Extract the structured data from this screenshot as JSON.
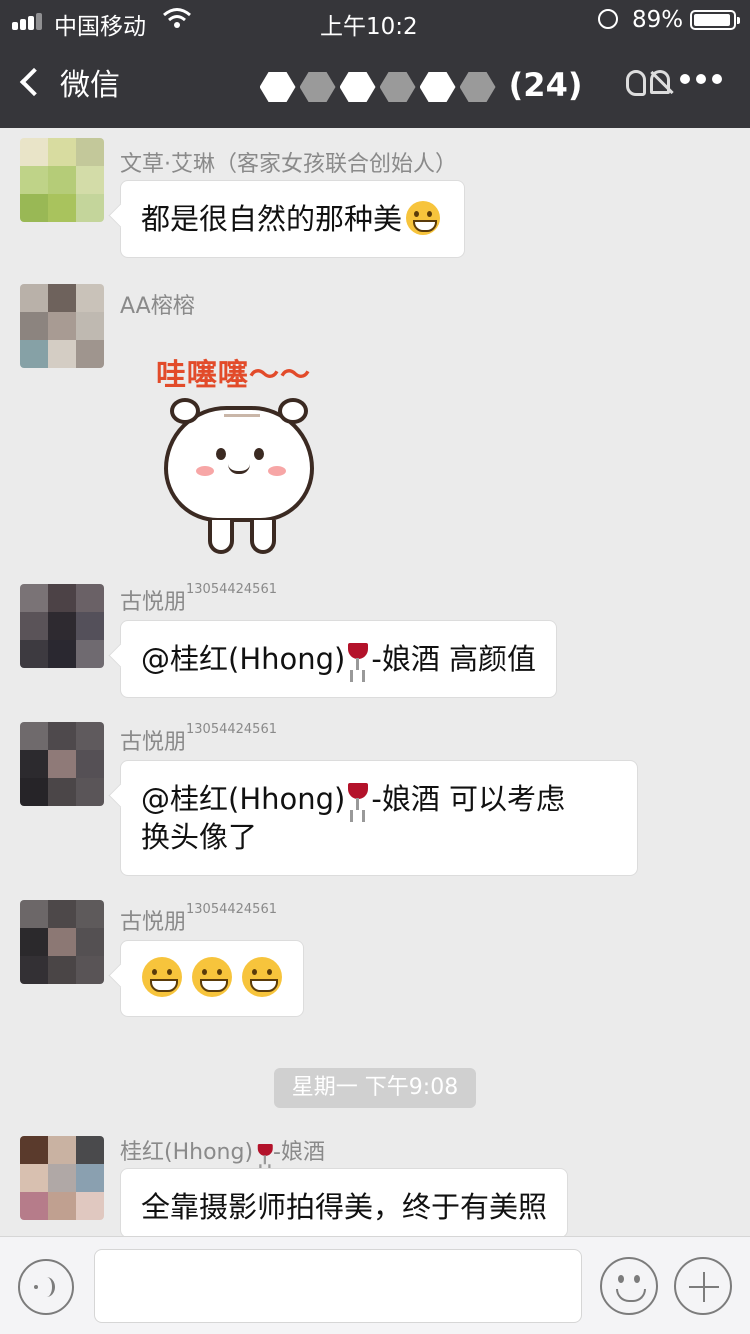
{
  "status_bar": {
    "carrier": "中国移动",
    "time": "上午10:2",
    "battery_percent": "89%"
  },
  "nav": {
    "back_label": "微信",
    "title": "(24)"
  },
  "messages": [
    {
      "sender": "文草·艾琳（客家女孩联合创始人）",
      "text": "都是很自然的那种美",
      "avatar_colors": [
        "#e9e4c8",
        "#d8dca0",
        "#c3c89a",
        "#bfd388",
        "#b5cc78",
        "#d3dca8",
        "#99b855",
        "#a9c35d",
        "#c4d59b"
      ]
    },
    {
      "sender": "AA榕榕",
      "sticker_text": "哇噻噻～～",
      "avatar_colors": [
        "#b9b1a9",
        "#6e625c",
        "#c9c2b9",
        "#8c847f",
        "#a89b93",
        "#bfb9b1",
        "#86a1a6",
        "#d4cdc4",
        "#9f958e"
      ]
    },
    {
      "sender": "古悦朋",
      "sender_suffix": "13054424561",
      "mention": "@桂红(Hhong)",
      "after_icon": "-娘酒 高颜值",
      "avatar_colors": [
        "#7a7376",
        "#4c4246",
        "#6a6166",
        "#5a5358",
        "#2e2a30",
        "#54505a",
        "#3d3a40",
        "#2a2830",
        "#6f6a70"
      ]
    },
    {
      "sender": "古悦朋",
      "sender_suffix": "13054424561",
      "mention": "@桂红(Hhong)",
      "after_icon": "-娘酒 可以考虑",
      "line2": "换头像了",
      "avatar_colors": [
        "#6f6a6c",
        "#4e494c",
        "#5f5a5d",
        "#2c2a2e",
        "#8f7a78",
        "#555055",
        "#262428",
        "#4b4648",
        "#5a5558"
      ]
    },
    {
      "sender": "古悦朋",
      "sender_suffix": "13054424561",
      "text": "",
      "avatar_colors": [
        "#6c6768",
        "#4d4849",
        "#5e5a5b",
        "#2b292c",
        "#8c7874",
        "#545052",
        "#333034",
        "#4a4546",
        "#595456"
      ]
    },
    {
      "sender_pre": "桂红(Hhong)",
      "sender_post": "-娘酒",
      "text": "全靠摄影师拍得美，终于有美照",
      "avatar_colors": [
        "#5a3a2c",
        "#c9b2a2",
        "#4a4a4c",
        "#d8c0b0",
        "#b0a8a6",
        "#8aa0b0",
        "#b67c8a",
        "#c0a090",
        "#e0c8c0"
      ]
    }
  ],
  "timestamp": "星期一 下午9:08",
  "icons": {
    "back": "chevron-left-icon",
    "ear": "ear-icon",
    "mute": "mute-icon",
    "more": "more-icon",
    "voice": "voice-icon",
    "emoji": "emoji-icon",
    "plus": "plus-icon",
    "wine": "wine-glass-icon",
    "grin": "grin-emoji-icon"
  },
  "colors": {
    "header_bg": "#36363a",
    "chat_bg": "#ebebeb",
    "bubble_bg": "#ffffff",
    "timestamp_bg": "#d0d0d0",
    "sticker_text": "#e24b2a"
  }
}
